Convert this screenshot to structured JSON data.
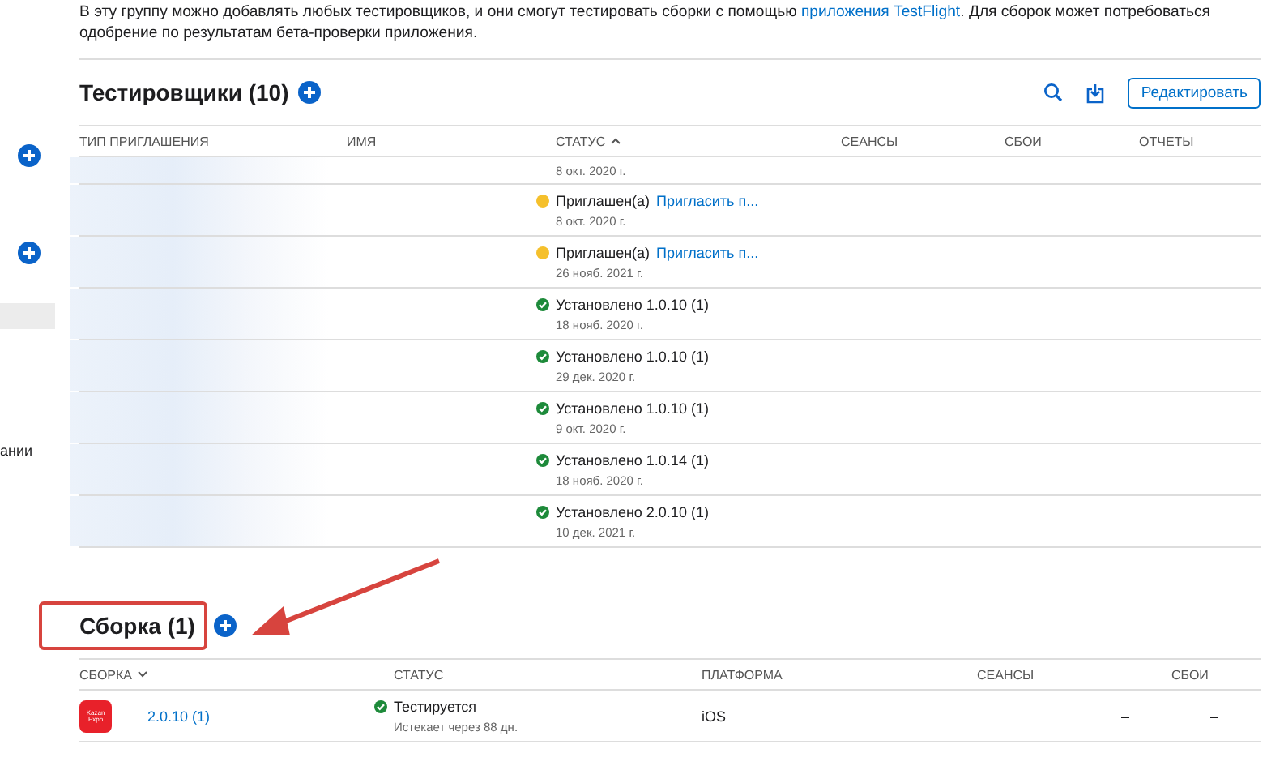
{
  "intro": {
    "text": "В эту группу можно добавлять любых тестировщиков, и они смогут тестировать сборки с помощью ",
    "link": "приложения TestFlight",
    "after": ". Для сборок может потребоваться одобрение по результатам бета-проверки приложения."
  },
  "sidebar": {
    "items": [
      {
        "kind": "add"
      },
      {
        "kind": "add"
      },
      {
        "kind": "bar",
        "selected": true
      },
      {
        "kind": "text",
        "label": "ании"
      }
    ]
  },
  "testers": {
    "title": "Тестировщики (10)",
    "edit_button": "Редактировать",
    "columns": [
      {
        "label": "ТИП ПРИГЛАШЕНИЯ",
        "sorted": false
      },
      {
        "label": "ИМЯ",
        "sorted": false
      },
      {
        "label": "СТАТУС",
        "sorted": true
      },
      {
        "label": "СЕАНСЫ",
        "sorted": false
      },
      {
        "label": "СБОИ",
        "sorted": false
      },
      {
        "label": "ОТЧЕТЫ",
        "sorted": false
      }
    ],
    "rows": [
      {
        "kind": "partial",
        "date": "8 окт. 2020 г."
      },
      {
        "kind": "invited",
        "status": "Приглашен(а)",
        "action": "Пригласить п...",
        "date": "8 окт. 2020 г."
      },
      {
        "kind": "invited",
        "status": "Приглашен(а)",
        "action": "Пригласить п...",
        "date": "26 нояб. 2021 г."
      },
      {
        "kind": "installed",
        "status": "Установлено 1.0.10 (1)",
        "date": "18 нояб. 2020 г."
      },
      {
        "kind": "installed",
        "status": "Установлено 1.0.10 (1)",
        "date": "29 дек. 2020 г."
      },
      {
        "kind": "installed",
        "status": "Установлено 1.0.10 (1)",
        "date": "9 окт. 2020 г."
      },
      {
        "kind": "installed",
        "status": "Установлено 1.0.14 (1)",
        "date": "18 нояб. 2020 г."
      },
      {
        "kind": "installed",
        "status": "Установлено 2.0.10 (1)",
        "date": "10 дек. 2021 г."
      }
    ]
  },
  "builds": {
    "title": "Сборка (1)",
    "annotation": {
      "kind": "box-and-arrow"
    },
    "columns": [
      {
        "label": "СБОРКА",
        "sorted": true
      },
      {
        "label": "СТАТУС",
        "sorted": false
      },
      {
        "label": "ПЛАТФОРМА",
        "sorted": false
      },
      {
        "label": "СЕАНСЫ",
        "sorted": false
      },
      {
        "label": "СБОИ",
        "sorted": false
      }
    ],
    "rows": [
      {
        "icon_text": "Kazan Expo",
        "version": "2.0.10 (1)",
        "status": "Тестируется",
        "expires": "Истекает через 88 дн.",
        "platform": "iOS",
        "sessions": "–",
        "crashes": "–"
      }
    ]
  }
}
